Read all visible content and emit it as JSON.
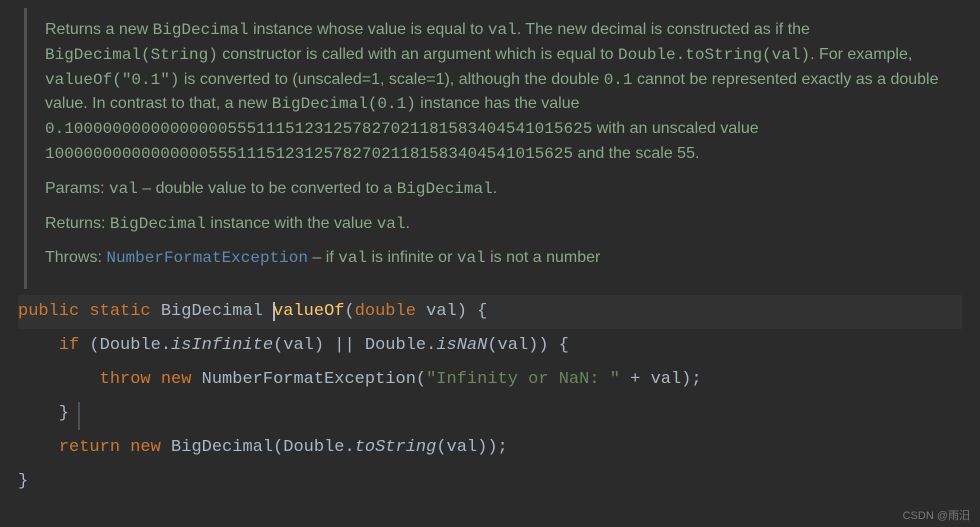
{
  "doc": {
    "desc_pre1": "Returns a new ",
    "desc_bigdecimal": "BigDecimal",
    "desc_pre2": " instance whose value is equal to ",
    "desc_val": "val",
    "desc_pre3": ". The new decimal is constructed as if the ",
    "desc_ctor": "BigDecimal(String)",
    "desc_pre4": " constructor is called with an argument which is equal to ",
    "desc_dts": "Double.toString(val)",
    "desc_pre5": ". For example, ",
    "desc_vof": "valueOf(\"0.1\")",
    "desc_pre6": " is converted to (unscaled=1, scale=1), although the double ",
    "desc_zero1": "0.1",
    "desc_pre7": " cannot be represented exactly as a double value. In contrast to that, a new ",
    "desc_ctor2": "BigDecimal(0.1)",
    "desc_pre8": " instance has the value ",
    "desc_longnum": "0.1000000000000000055511151231257827021181583404541015625",
    "desc_pre9": " with an unscaled value ",
    "desc_unscaled": "1000000000000000055511151231257827021181583404541015625",
    "desc_pre10": " and the scale 55.",
    "params_label": "Params: ",
    "params_name": "val",
    "params_desc": " – double value to be converted to a ",
    "params_type": "BigDecimal",
    "params_end": ".",
    "returns_label": "Returns: ",
    "returns_type": "BigDecimal",
    "returns_desc1": " instance with the value ",
    "returns_val": "val",
    "returns_end": ".",
    "throws_label": "Throws: ",
    "throws_exc": "NumberFormatException",
    "throws_desc1": " – if ",
    "throws_v1": "val",
    "throws_desc2": " is infinite or ",
    "throws_v2": "val",
    "throws_desc3": " is not a number"
  },
  "code": {
    "sig_public": "public",
    "sig_static": "static",
    "sig_ret": "BigDecimal",
    "sig_name": "valueOf",
    "sig_ptype": "double",
    "sig_pname": "val",
    "if_kw": "if",
    "dbl": "Double",
    "isinf": "isInfinite",
    "arg": "val",
    "or": "||",
    "isnan": "isNaN",
    "throw_kw": "throw",
    "new_kw": "new",
    "nfe": "NumberFormatException",
    "msg": "\"Infinity or NaN: \"",
    "plus": "+",
    "return_kw": "return",
    "bd": "BigDecimal",
    "tostring": "toString"
  },
  "watermark": "CSDN @雨汨"
}
